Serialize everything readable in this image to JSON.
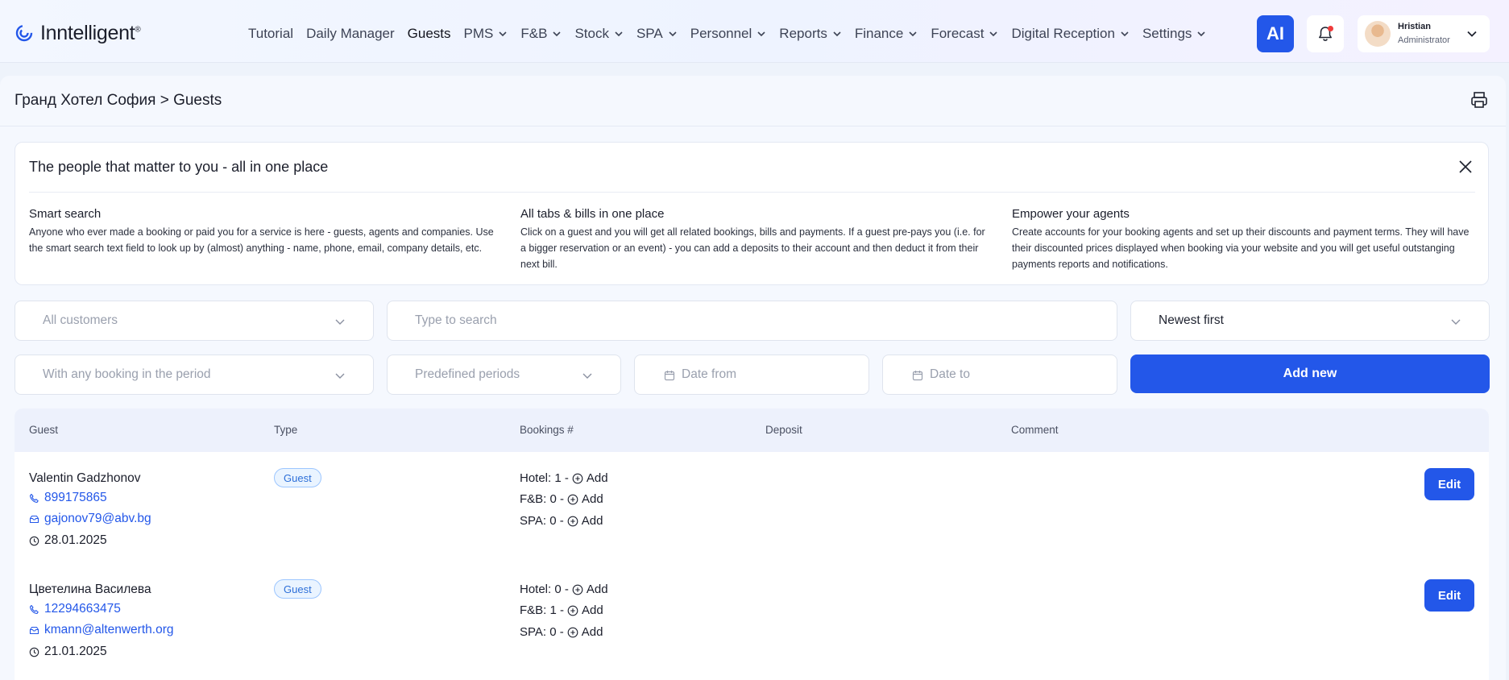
{
  "app": {
    "logo_text": "Inntelligent",
    "logo_mark": "®"
  },
  "nav": {
    "items": [
      {
        "label": "Tutorial",
        "dropdown": false
      },
      {
        "label": "Daily Manager",
        "dropdown": false
      },
      {
        "label": "Guests",
        "dropdown": false,
        "active": true
      },
      {
        "label": "PMS",
        "dropdown": true
      },
      {
        "label": "F&B",
        "dropdown": true
      },
      {
        "label": "Stock",
        "dropdown": true
      },
      {
        "label": "SPA",
        "dropdown": true
      },
      {
        "label": "Personnel",
        "dropdown": true
      },
      {
        "label": "Reports",
        "dropdown": true
      },
      {
        "label": "Finance",
        "dropdown": true
      },
      {
        "label": "Forecast",
        "dropdown": true
      },
      {
        "label": "Digital Reception",
        "dropdown": true
      },
      {
        "label": "Settings",
        "dropdown": true
      }
    ],
    "ai_label": "AI"
  },
  "user": {
    "name": "Hristian",
    "role": "Administrator"
  },
  "page": {
    "breadcrumb": "Гранд Хотел София > Guests"
  },
  "info": {
    "title": "The people that matter to you - all in one place",
    "columns": [
      {
        "heading": "Smart search",
        "text": "Anyone who ever made a booking or paid you for a service is here - guests, agents and companies. Use the smart search text field to look up by (almost) anything - name, phone, email, company details, etc."
      },
      {
        "heading": "All tabs & bills in one place",
        "text": "Click on a guest and you will get all related bookings, bills and payments. If a guest pre-pays you (i.e. for a bigger reservation or an event) - you can add a deposits to their account and then deduct it from their next bill."
      },
      {
        "heading": "Empower your agents",
        "text": "Create accounts for your booking agents and set up their discounts and payment terms. They will have their discounted prices displayed when booking via your website and you will get useful outstanging payments reports and notifications."
      }
    ]
  },
  "filters": {
    "customers": "All customers",
    "search_placeholder": "Type to search",
    "sort": "Newest first",
    "booking_period": "With any booking in the period",
    "predefined": "Predefined periods",
    "date_from": "Date from",
    "date_to": "Date to",
    "add_new": "Add new"
  },
  "table": {
    "columns": [
      "Guest",
      "Type",
      "Bookings #",
      "Deposit",
      "Comment"
    ],
    "add_label": "Add",
    "edit_label": "Edit",
    "rows": [
      {
        "name": "Valentin Gadzhonov",
        "phone": "899175865",
        "email": "gajonov79@abv.bg",
        "date": "28.01.2025",
        "type": "Guest",
        "hotel": "Hotel: 1 -",
        "fb": "F&B: 0 -",
        "spa": "SPA: 0 -"
      },
      {
        "name": "Цветелина Василева",
        "phone": "12294663475",
        "email": "kmann@altenwerth.org",
        "date": "21.01.2025",
        "type": "Guest",
        "hotel": "Hotel: 0 -",
        "fb": "F&B: 1 -",
        "spa": "SPA: 0 -"
      }
    ]
  },
  "colors": {
    "accent": "#2357e9",
    "badge_border": "#9cc6ff",
    "notification_dot": "#ef3b3b"
  }
}
